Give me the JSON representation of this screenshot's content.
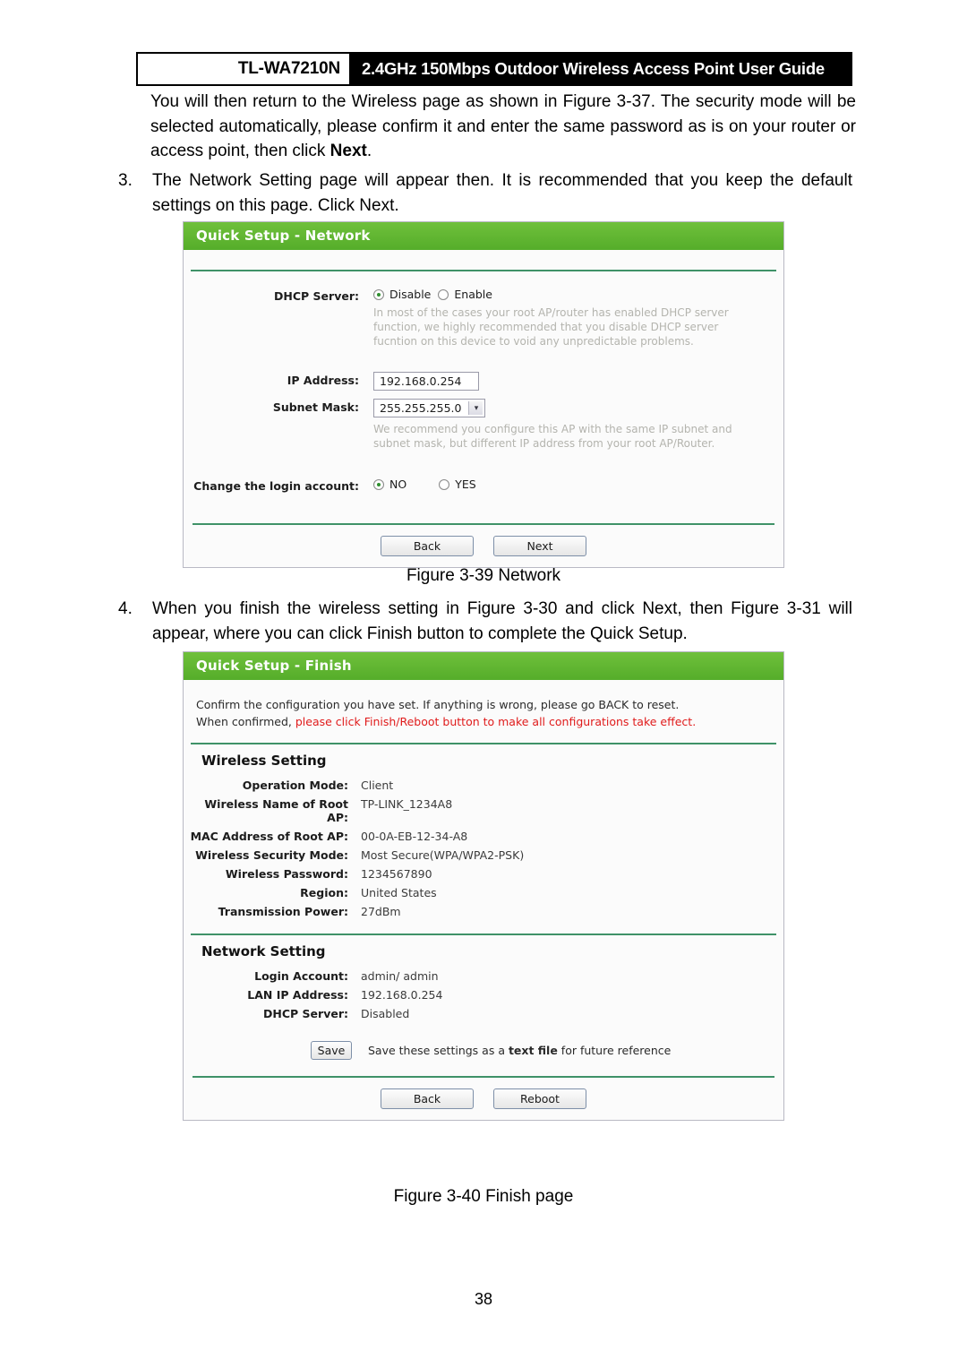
{
  "header": {
    "model": "TL-WA7210N",
    "title": "2.4GHz 150Mbps Outdoor Wireless Access Point User Guide"
  },
  "lead_paragraph": {
    "part1": "You will then return to the Wireless page as shown in Figure 3-37. The security mode will be selected automatically, please confirm it and enter the same password as is on your router or access point, then click ",
    "bold1": "Next",
    "part2": "."
  },
  "item3": {
    "number": "3.",
    "part1": "The Network Setting page will appear then. It is recommended that you keep the default settings on this page. Click ",
    "bold1": "Next",
    "part2": "."
  },
  "item4": {
    "number": "4.",
    "part1": "When you finish the wireless setting in Figure 3-30 and click ",
    "bold1": "Next",
    "part2": ", then Figure 3-31 will appear, where you can click ",
    "bold2": "Finish",
    "part3": " button to complete the ",
    "bold3": "Quick Setup",
    "part4": "."
  },
  "figure_39": {
    "caption": "Figure 3-39 Network",
    "panel_title": "Quick Setup - Network",
    "dhcp": {
      "label": "DHCP Server:",
      "option_disable": "Disable",
      "option_enable": "Enable",
      "selected": "Disable",
      "hint": "In most of the cases your root AP/router has enabled DHCP server function, we highly recommended that you disable DHCP server fucntion on this device to void any unpredictable problems."
    },
    "ip_address": {
      "label": "IP Address:",
      "value": "192.168.0.254"
    },
    "subnet_mask": {
      "label": "Subnet Mask:",
      "value": "255.255.255.0",
      "arrow_glyph": "▾",
      "hint": "We recommend you configure this AP with the same IP subnet and subnet mask, but different IP address from your root AP/Router."
    },
    "login_account": {
      "label": "Change the login account:",
      "option_no": "NO",
      "option_yes": "YES",
      "selected": "NO"
    },
    "buttons": {
      "back": "Back",
      "next": "Next"
    }
  },
  "figure_40": {
    "caption": "Figure 3-40 Finish page",
    "panel_title": "Quick Setup - Finish",
    "confirm": {
      "line1": "Confirm the configuration you have set. If anything is wrong, please go BACK to reset.",
      "line2_prefix": "When confirmed, ",
      "line2_red": "please click Finish/Reboot button to make all configurations take effect."
    },
    "wireless_setting": {
      "heading": "Wireless Setting",
      "rows": [
        {
          "label": "Operation Mode:",
          "value": "Client"
        },
        {
          "label": "Wireless Name of Root AP:",
          "value": "TP-LINK_1234A8"
        },
        {
          "label": "MAC Address of Root AP:",
          "value": "00-0A-EB-12-34-A8"
        },
        {
          "label": "Wireless Security Mode:",
          "value": "Most Secure(WPA/WPA2-PSK)"
        },
        {
          "label": "Wireless Password:",
          "value": "1234567890"
        },
        {
          "label": "Region:",
          "value": "United States"
        },
        {
          "label": "Transmission Power:",
          "value": "27dBm"
        }
      ]
    },
    "network_setting": {
      "heading": "Network Setting",
      "rows": [
        {
          "label": "Login Account:",
          "value": "admin/ admin"
        },
        {
          "label": "LAN IP Address:",
          "value": "192.168.0.254"
        },
        {
          "label": "DHCP Server:",
          "value": "Disabled"
        }
      ]
    },
    "save": {
      "button": "Save",
      "text_prefix": "Save these settings as a ",
      "text_bold": "text file",
      "text_suffix": " for future reference"
    },
    "buttons": {
      "back": "Back",
      "reboot": "Reboot"
    }
  },
  "page_number": "38",
  "colors": {
    "panel_green": "#5cb531",
    "rule_green": "#3f9268",
    "warning_red": "#e01b1b",
    "hint_gray": "#b4b4ae"
  }
}
